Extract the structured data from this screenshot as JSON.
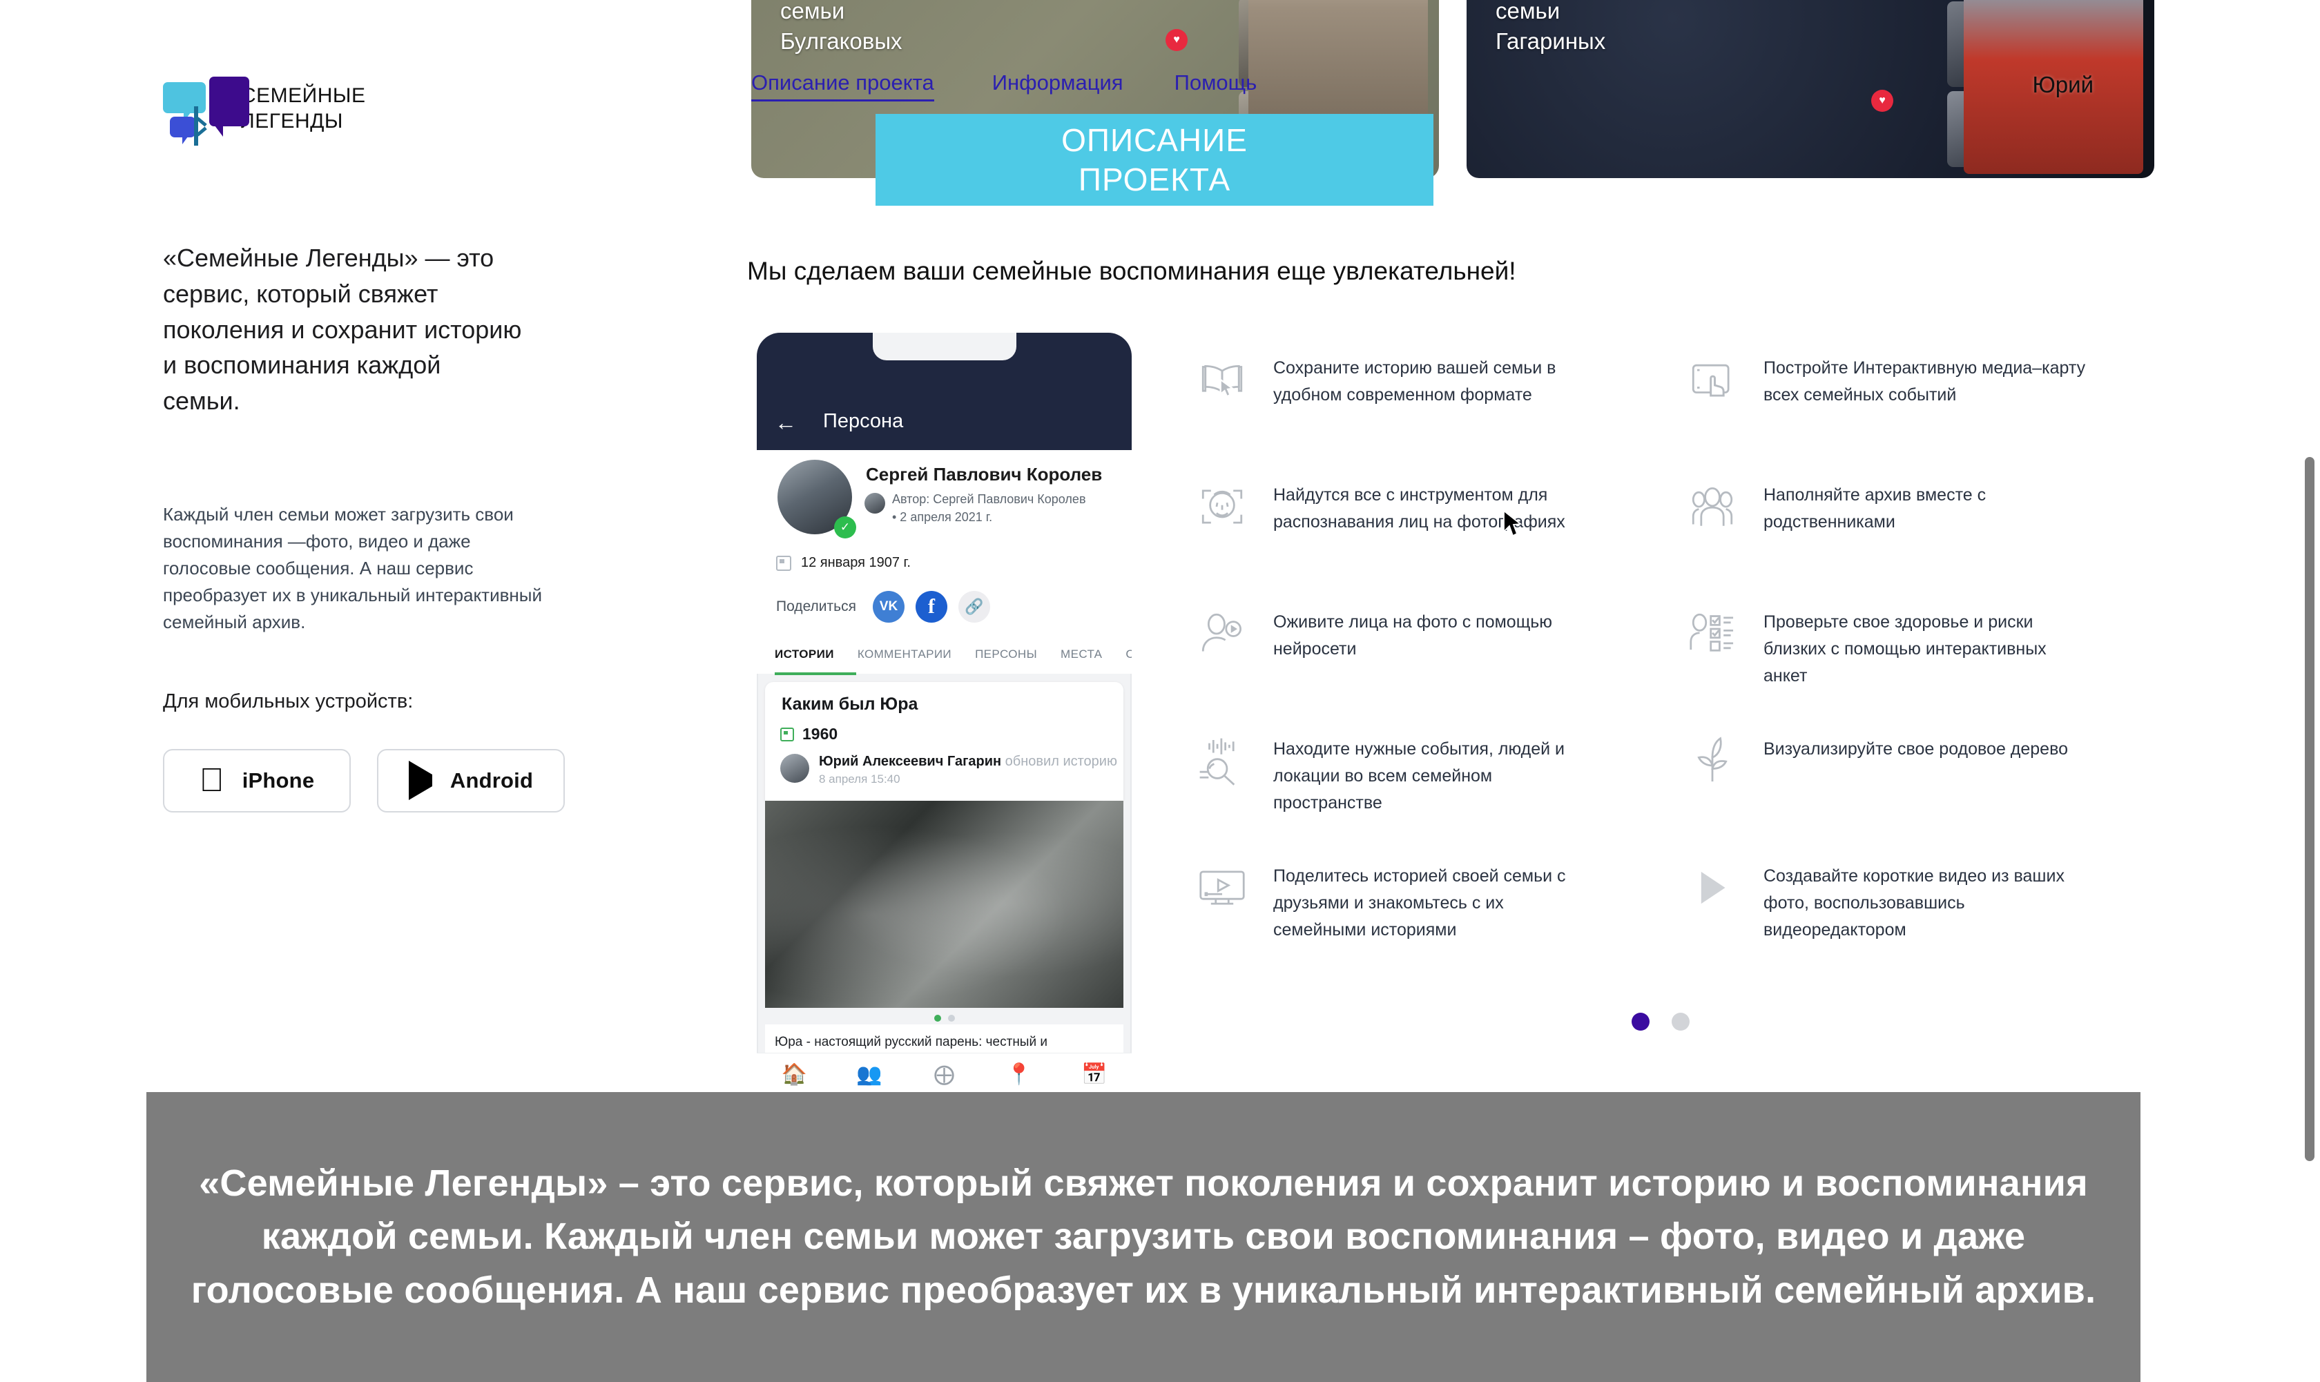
{
  "brand": {
    "logo_text": "СЕМЕЙНЫЕ\nЛЕГЕНДЫ",
    "accent_cyan": "#4ecae6",
    "accent_purple": "#3a0ba0",
    "logo_bubble_cyan": "#4ec3e0",
    "logo_bubble_purple": "#3d0b8c",
    "logo_bubble_blue": "#3b4fd6"
  },
  "left": {
    "lead": "«Семейные Легенды» — это сервис, который свяжет поколения и сохранит историю и воспоминания каждой семьи.",
    "sub": "Каждый член семьи может загрузить свои воспоминания —фото, видео и даже голосовые сообщения. А наш сервис преобразует их в уникальный интерактивный семейный архив.",
    "mobile_label": "Для мобильных устройств:",
    "stores": [
      {
        "label": "iPhone",
        "icon": "apple-icon"
      },
      {
        "label": "Android",
        "icon": "google-play-icon"
      }
    ]
  },
  "nav": {
    "items": [
      {
        "label": "Описание проекта",
        "active": true
      },
      {
        "label": "Информация",
        "active": false
      },
      {
        "label": "Помощь",
        "active": false
      }
    ]
  },
  "banner": {
    "line1": "ОПИСАНИЕ",
    "line2": "ПРОЕКТА"
  },
  "headline": "Мы сделаем ваши семейные воспоминания еще увлекательней!",
  "promo_cards": [
    {
      "title": "семьи\nБулгаковых",
      "hero_name": ""
    },
    {
      "title": "семьи\nГагариных",
      "hero_name": "Юрий"
    }
  ],
  "phone": {
    "screen_title": "Персона",
    "back_icon": "back-arrow-icon",
    "person_name": "Сергей Павлович Королев",
    "author_line": "Автор: Сергей Павлович Королев\n• 2 апреля 2021 г.",
    "birth_date": "12 января 1907 г.",
    "share_label": "Поделиться",
    "share_buttons": [
      "vk-icon",
      "facebook-icon",
      "copy-link-icon"
    ],
    "tabs": [
      "ИСТОРИИ",
      "КОММЕНТАРИИ",
      "ПЕРСОНЫ",
      "МЕСТА",
      "С"
    ],
    "active_tab": "ИСТОРИИ",
    "story": {
      "title": "Каким был Юра",
      "year": "1960",
      "updater_name": "Юрий Алексеевич Гагарин",
      "updater_action": " обновил историю",
      "updater_time": "8 апреля 15:40",
      "body": "Юра - настоящий русский парень: честный и добросовестный, открытый и жизнерадостный, смелый и талантливый и очень",
      "photo_dots": 2,
      "photo_dot_active": 0
    },
    "bottom_nav": [
      "home-icon",
      "people-icon",
      "add-circle-icon",
      "location-pin-icon",
      "calendar-icon"
    ]
  },
  "features": [
    {
      "icon": "open-book-cursor-icon",
      "text": "Сохраните историю вашей семьи в удобном современном формате"
    },
    {
      "icon": "tablet-touch-icon",
      "text": "Постройте Интерактивную медиа–карту всех семейных событий"
    },
    {
      "icon": "face-recognition-icon",
      "text": "Найдутся все с инструментом для распознавания лиц на фотографиях"
    },
    {
      "icon": "group-people-icon",
      "text": "Наполняйте архив вместе с родственниками"
    },
    {
      "icon": "person-play-icon",
      "text": "Оживите лица на фото с помощью нейросети"
    },
    {
      "icon": "person-checklist-icon",
      "text": "Проверьте свое здоровье и риски близких с помощью интерактивных анкет"
    },
    {
      "icon": "voice-search-icon",
      "text": "Находите нужные события, людей и локации во всем семейном пространстве"
    },
    {
      "icon": "sprout-icon",
      "text": "Визуализируйте свое родовое дерево"
    },
    {
      "icon": "monitor-play-icon",
      "text": "Поделитесь историей своей семьи с друзьями и знакомьтесь с их семейными историями"
    },
    {
      "icon": "play-triangle-icon",
      "text": "Создавайте короткие видео из ваших фото, воспользовавшись видеоредактором"
    }
  ],
  "carousel": {
    "dots": 2,
    "active": 0,
    "active_color": "#3a0ba0",
    "inactive_color": "#d2d4d8"
  },
  "subtitle": "«Семейные Легенды» – это сервис, который свяжет поколения и сохранит историю и воспоминания каждой семьи. Каждый член семьи может загрузить свои воспоминания – фото, видео и даже голосовые сообщения. А наш сервис преобразует их в уникальный интерактивный семейный архив.",
  "scrollbar": {
    "color": "#7d7d7d"
  }
}
